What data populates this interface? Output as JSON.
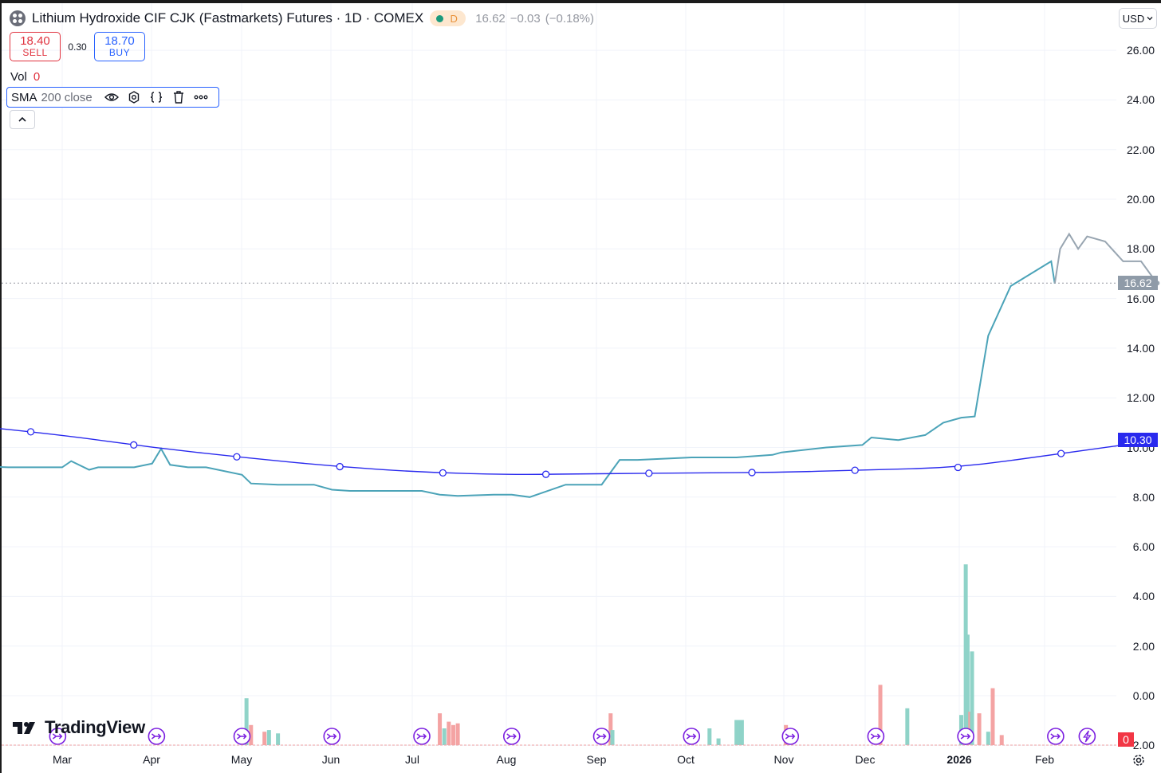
{
  "header": {
    "title": "Lithium Hydroxide CIF CJK (Fastmarkets) Futures · 1D · COMEX",
    "status_letter": "D",
    "last": "16.62",
    "change": "−0.03",
    "change_pct": "(−0.18%)"
  },
  "trade": {
    "sell_price": "18.40",
    "sell_label": "SELL",
    "spread": "0.30",
    "buy_price": "18.70",
    "buy_label": "BUY"
  },
  "volume": {
    "label": "Vol",
    "value": "0"
  },
  "indicator": {
    "name": "SMA",
    "params": "200 close"
  },
  "currency": "USD",
  "price_tag": "16.62",
  "sma_tag": "10.30",
  "volume_tag": "0",
  "logo": "TradingView",
  "colors": {
    "price_line": "#4ba3b8",
    "price_line_recent": "#98a5b1",
    "sma_line": "#2a2aee",
    "vol_up": "#8fd3c8",
    "vol_down": "#f4a3a3",
    "event_icon": "#7b1fe0",
    "tag_price": "#8f9ba8",
    "tag_sma": "#2a2aee"
  },
  "chart_data": {
    "type": "line",
    "x_tick_labels": [
      "Mar",
      "Apr",
      "May",
      "Jun",
      "Jul",
      "Aug",
      "Sep",
      "Oct",
      "Nov",
      "Dec",
      "2026",
      "Feb"
    ],
    "y_ticks": [
      "26.00",
      "24.00",
      "22.00",
      "20.00",
      "18.00",
      "16.00",
      "14.00",
      "12.00",
      "10.00",
      "8.00",
      "6.00",
      "4.00",
      "2.00",
      "0.00",
      "−2.00"
    ],
    "ylim": [
      -2,
      27
    ],
    "grid": true,
    "series": [
      {
        "name": "Close",
        "x": [
          -1.35,
          -1.0,
          -0.6,
          0.0,
          0.1,
          0.3,
          0.4,
          0.8,
          1.0,
          1.1,
          1.2,
          1.4,
          1.6,
          2.0,
          2.1,
          2.4,
          2.8,
          3.0,
          3.2,
          3.4,
          3.5,
          4.0,
          4.2,
          4.4,
          4.8,
          5.0,
          5.2,
          5.6,
          6.0,
          6.2,
          6.4,
          7.0,
          7.2,
          7.5,
          7.9,
          8.0,
          8.5,
          8.9,
          9.0,
          9.3,
          9.6,
          9.8,
          10.0,
          10.15,
          10.3,
          10.55,
          11.0,
          11.04,
          11.1,
          11.2,
          11.3,
          11.4,
          11.5,
          11.6,
          11.8,
          12.0,
          12.1,
          12.18
        ],
        "y": [
          9.3,
          9.25,
          9.2,
          9.2,
          9.45,
          9.1,
          9.2,
          9.2,
          9.35,
          9.95,
          9.3,
          9.2,
          9.2,
          8.9,
          8.55,
          8.5,
          8.5,
          8.3,
          8.25,
          8.25,
          8.25,
          8.25,
          8.1,
          8.05,
          8.1,
          8.1,
          8.0,
          8.5,
          8.5,
          9.5,
          9.5,
          9.6,
          9.6,
          9.6,
          9.7,
          9.8,
          10.0,
          10.1,
          10.4,
          10.3,
          10.5,
          11.0,
          11.2,
          11.25,
          14.5,
          16.5,
          17.5,
          16.6,
          18.0,
          18.6,
          18.0,
          18.5,
          18.4,
          18.3,
          17.5,
          17.5,
          17.0,
          16.62
        ]
      },
      {
        "name": "SMA 200",
        "x": [
          -1.35,
          0.0,
          1.0,
          2.0,
          3.0,
          4.0,
          5.0,
          6.0,
          7.0,
          8.0,
          9.0,
          10.0,
          11.0,
          12.0,
          12.18
        ],
        "y": [
          11.0,
          10.5,
          10.0,
          9.6,
          9.25,
          9.0,
          8.9,
          8.95,
          8.97,
          9.0,
          9.1,
          9.2,
          9.7,
          10.2,
          10.3
        ]
      }
    ],
    "volume": {
      "name": "Vol",
      "x": [
        -1.1,
        2.05,
        2.1,
        2.25,
        2.3,
        2.4,
        4.2,
        4.25,
        4.3,
        4.35,
        4.4,
        6.1,
        6.12,
        7.2,
        7.3,
        7.5,
        7.53,
        7.56,
        8.05,
        9.1,
        9.4,
        10.0,
        10.05,
        10.07,
        10.1,
        10.12,
        10.2,
        10.3,
        10.35,
        10.45
      ],
      "values": [
        0.2,
        1.4,
        0.6,
        0.4,
        0.45,
        0.35,
        0.95,
        0.5,
        0.7,
        0.6,
        0.65,
        0.95,
        0.45,
        0.5,
        0.2,
        0.75,
        0.75,
        0.75,
        0.6,
        1.8,
        1.1,
        0.9,
        5.4,
        3.3,
        1.0,
        2.8,
        0.95,
        0.4,
        1.7,
        0.3
      ],
      "up": [
        false,
        true,
        false,
        false,
        true,
        true,
        false,
        true,
        false,
        false,
        false,
        false,
        true,
        true,
        true,
        true,
        true,
        true,
        false,
        false,
        true,
        true,
        true,
        true,
        false,
        true,
        false,
        true,
        false,
        false
      ]
    },
    "event_markers": [
      -0.05,
      1.05,
      2.0,
      3.0,
      4.0,
      5.0,
      6.0,
      7.0,
      8.1,
      9.05,
      10.05,
      11.05,
      11.4
    ]
  }
}
